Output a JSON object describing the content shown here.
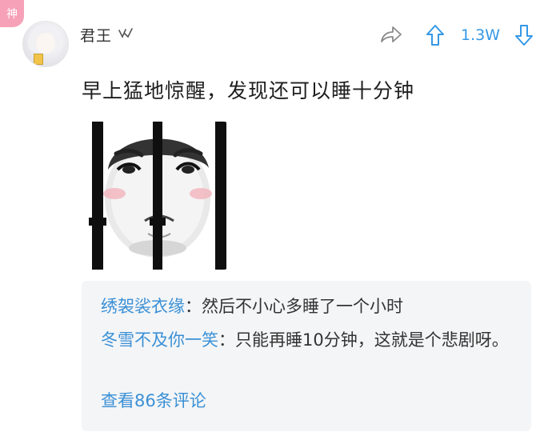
{
  "badge": {
    "label": "神"
  },
  "post": {
    "username": "君王",
    "text": "早上猛地惊醒，发现还可以睡十分钟",
    "likes": "1.3W"
  },
  "icons": {
    "share": "share-icon",
    "up": "upvote-arrow-icon",
    "down": "downvote-arrow-icon",
    "verified": "verified-mark-icon"
  },
  "comments": [
    {
      "name": "绣袈裟衣缘",
      "separator": "：",
      "text": "然后不小心多睡了一个小时"
    },
    {
      "name": "冬雪不及你一笑",
      "separator": "：",
      "text": "只能再睡10分钟，这就是个悲剧呀。"
    }
  ],
  "view_more": "查看86条评论",
  "colors": {
    "accent": "#3598e6",
    "comment_name": "#3a90d6",
    "comment_bg": "#f4f5f7",
    "badge": "#f7a1b8"
  }
}
